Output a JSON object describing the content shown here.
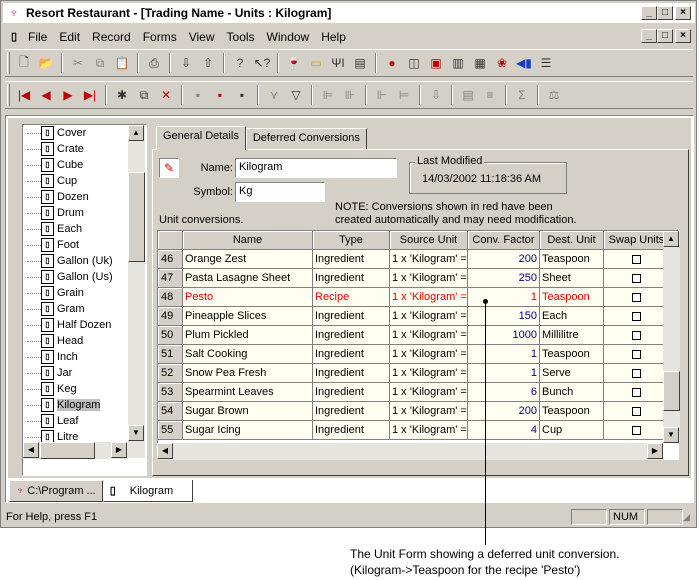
{
  "window": {
    "title": "Resort Restaurant - [Trading Name - Units : Kilogram]",
    "controls": [
      "_",
      "□",
      "×"
    ],
    "mdi_controls": [
      "_",
      "□",
      "×"
    ]
  },
  "menu": [
    "File",
    "Edit",
    "Record",
    "Forms",
    "View",
    "Tools",
    "Window",
    "Help"
  ],
  "toolbar1_icons": [
    "new-icon",
    "open-icon",
    "cut-icon",
    "copy-icon",
    "paste-icon",
    "print-icon",
    "import-icon",
    "export-icon",
    "help-icon",
    "context-help-icon",
    "wine-icon",
    "ingredient-icon",
    "utensils-icon",
    "document-icon",
    "tomato-icon",
    "dish-icon",
    "report-icon",
    "book-icon",
    "doc2-icon",
    "balloons-icon",
    "truck-icon",
    "list-icon"
  ],
  "toolbar2_icons": [
    "first-icon",
    "prev-icon",
    "next-icon",
    "last-icon",
    "new-record-icon",
    "copy-record-icon",
    "delete-icon",
    "save-icon",
    "save-all-icon",
    "save-close-icon",
    "filter-off-icon",
    "filter-icon"
  ],
  "tree": {
    "items": [
      "Cover",
      "Crate",
      "Cube",
      "Cup",
      "Dozen",
      "Drum",
      "Each",
      "Foot",
      "Gallon (Uk)",
      "Gallon (Us)",
      "Grain",
      "Gram",
      "Half Dozen",
      "Head",
      "Inch",
      "Jar",
      "Keg",
      "Kilogram",
      "Leaf",
      "Litre"
    ],
    "selected": "Kilogram"
  },
  "tabs": {
    "general": "General Details",
    "deferred": "Deferred Conversions"
  },
  "form": {
    "name_label": "Name:",
    "name_value": "Kilogram",
    "symbol_label": "Symbol:",
    "symbol_value": "Kg",
    "last_modified_label": "Last Modified",
    "last_modified_value": "14/03/2002 11:18:36 AM",
    "unit_conversions_label": "Unit conversions.",
    "note": "NOTE: Conversions shown in red have been created automatically and may need modification."
  },
  "grid": {
    "headers": [
      "",
      "Name",
      "Type",
      "Source Unit",
      "Conv. Factor",
      "Dest. Unit",
      "Swap Units"
    ],
    "rows": [
      {
        "n": "46",
        "name": "Orange Zest",
        "type": "Ingredient",
        "src": "1 x 'Kilogram' =",
        "factor": "200",
        "dest": "Teaspoon",
        "red": false
      },
      {
        "n": "47",
        "name": "Pasta Lasagne Sheet",
        "type": "Ingredient",
        "src": "1 x 'Kilogram' =",
        "factor": "250",
        "dest": "Sheet",
        "red": false
      },
      {
        "n": "48",
        "name": "Pesto",
        "type": "Recipe",
        "src": "1 x 'Kilogram' =",
        "factor": "1",
        "dest": "Teaspoon",
        "red": true
      },
      {
        "n": "49",
        "name": "Pineapple Slices",
        "type": "Ingredient",
        "src": "1 x 'Kilogram' =",
        "factor": "150",
        "dest": "Each",
        "red": false
      },
      {
        "n": "50",
        "name": "Plum Pickled",
        "type": "Ingredient",
        "src": "1 x 'Kilogram' =",
        "factor": "1000",
        "dest": "Millilitre",
        "red": false
      },
      {
        "n": "51",
        "name": "Salt Cooking",
        "type": "Ingredient",
        "src": "1 x 'Kilogram' =",
        "factor": "1",
        "dest": "Teaspoon",
        "red": false
      },
      {
        "n": "52",
        "name": "Snow Pea Fresh",
        "type": "Ingredient",
        "src": "1 x 'Kilogram' =",
        "factor": "1",
        "dest": "Serve",
        "red": false
      },
      {
        "n": "53",
        "name": "Spearmint Leaves",
        "type": "Ingredient",
        "src": "1 x 'Kilogram' =",
        "factor": "6",
        "dest": "Bunch",
        "red": false
      },
      {
        "n": "54",
        "name": "Sugar Brown",
        "type": "Ingredient",
        "src": "1 x 'Kilogram' =",
        "factor": "200",
        "dest": "Teaspoon",
        "red": false
      },
      {
        "n": "55",
        "name": "Sugar Icing",
        "type": "Ingredient",
        "src": "1 x 'Kilogram' =",
        "factor": "4",
        "dest": "Cup",
        "red": false
      }
    ]
  },
  "bottom_tabs": [
    "C:\\Program ...",
    "Kilogram"
  ],
  "status": {
    "text": "For Help, press F1",
    "num": "NUM"
  },
  "caption": {
    "line1": "The Unit Form showing a deferred unit conversion.",
    "line2": "(Kilogram->Teaspoon for the recipe 'Pesto')"
  },
  "colors": {
    "red_row": "#e00000",
    "factor_blue": "#00008b",
    "row_bg": "#fffef0"
  }
}
